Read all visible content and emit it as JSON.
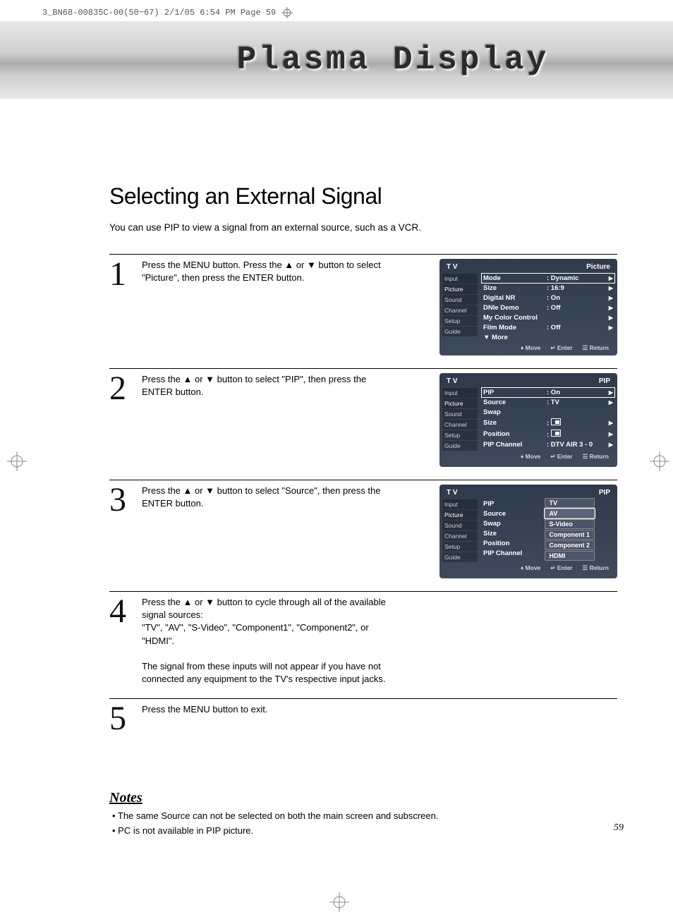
{
  "print_header": "3_BN68-00835C-00(50~67)  2/1/05  6:54 PM  Page 59",
  "banner_title": "Plasma Display",
  "page_title": "Selecting an External Signal",
  "intro": "You can use PIP to view a signal from an external source, such as a VCR.",
  "sidebar_items": [
    "Input",
    "Picture",
    "Sound",
    "Channel",
    "Setup",
    "Guide"
  ],
  "steps": [
    {
      "num": "1",
      "text": "Press the MENU button. Press the ▲ or ▼ button to select \"Picture\", then press the ENTER button.",
      "osd": {
        "head_left": "T V",
        "head_right": "Picture",
        "rows": [
          {
            "label": "Mode",
            "value": ": Dynamic",
            "selected": true,
            "arrow": true
          },
          {
            "label": "Size",
            "value": ": 16:9",
            "arrow": true
          },
          {
            "label": "Digital NR",
            "value": ": On",
            "arrow": true
          },
          {
            "label": "DNIe Demo",
            "value": ": Off",
            "arrow": true
          },
          {
            "label": "My Color Control",
            "value": "",
            "arrow": true
          },
          {
            "label": "Film Mode",
            "value": ": Off",
            "arrow": true
          },
          {
            "label": "▼ More",
            "value": "",
            "arrow": false
          }
        ],
        "footer": [
          "Move",
          "Enter",
          "Return"
        ]
      }
    },
    {
      "num": "2",
      "text": "Press the ▲ or ▼ button to select \"PIP\", then press the ENTER button.",
      "osd": {
        "head_left": "T V",
        "head_right": "PIP",
        "rows": [
          {
            "label": "PIP",
            "value": ": On",
            "selected": true,
            "arrow": true
          },
          {
            "label": "Source",
            "value": ": TV",
            "arrow": true
          },
          {
            "label": "Swap",
            "value": "",
            "arrow": false
          },
          {
            "label": "Size",
            "value_icon": "a",
            "value": ":",
            "arrow": true
          },
          {
            "label": "Position",
            "value_icon": "b",
            "value": ":",
            "arrow": true
          },
          {
            "label": "PIP Channel",
            "value": ": DTV AIR 3 - 0",
            "arrow": true
          }
        ],
        "footer": [
          "Move",
          "Enter",
          "Return"
        ]
      }
    },
    {
      "num": "3",
      "text": "Press the ▲ or ▼ button to select \"Source\", then press the ENTER button.",
      "osd": {
        "head_left": "T V",
        "head_right": "PIP",
        "rows": [
          {
            "label": "PIP",
            "value": ":"
          },
          {
            "label": "Source",
            "value": ":"
          },
          {
            "label": "Swap",
            "value": ""
          },
          {
            "label": "Size",
            "value": ":"
          },
          {
            "label": "Position",
            "value": ":"
          },
          {
            "label": "PIP Channel",
            "value": ":"
          }
        ],
        "popup": [
          "TV",
          "AV",
          "S-Video",
          "Component 1",
          "Component 2",
          "HDMI"
        ],
        "popup_selected": 1,
        "footer": [
          "Move",
          "Enter",
          "Return"
        ]
      }
    },
    {
      "num": "4",
      "text_lines": [
        "Press the ▲ or ▼ button to cycle through all of the available signal sources:",
        "\"TV\", \"AV\", \"S-Video\", \"Component1\", \"Component2\", or \"HDMI\".",
        "",
        "The signal from these inputs will not appear if you have not connected any equipment to the TV's respective input jacks."
      ]
    },
    {
      "num": "5",
      "text": "Press the MENU button to exit."
    }
  ],
  "notes_title": "Notes",
  "notes": [
    "The same Source can not be selected on both the main screen and subscreen.",
    "PC is not available in PIP picture."
  ],
  "page_number": "59",
  "footer_icons": {
    "move": "♦",
    "enter": "↵",
    "return": "☰"
  }
}
